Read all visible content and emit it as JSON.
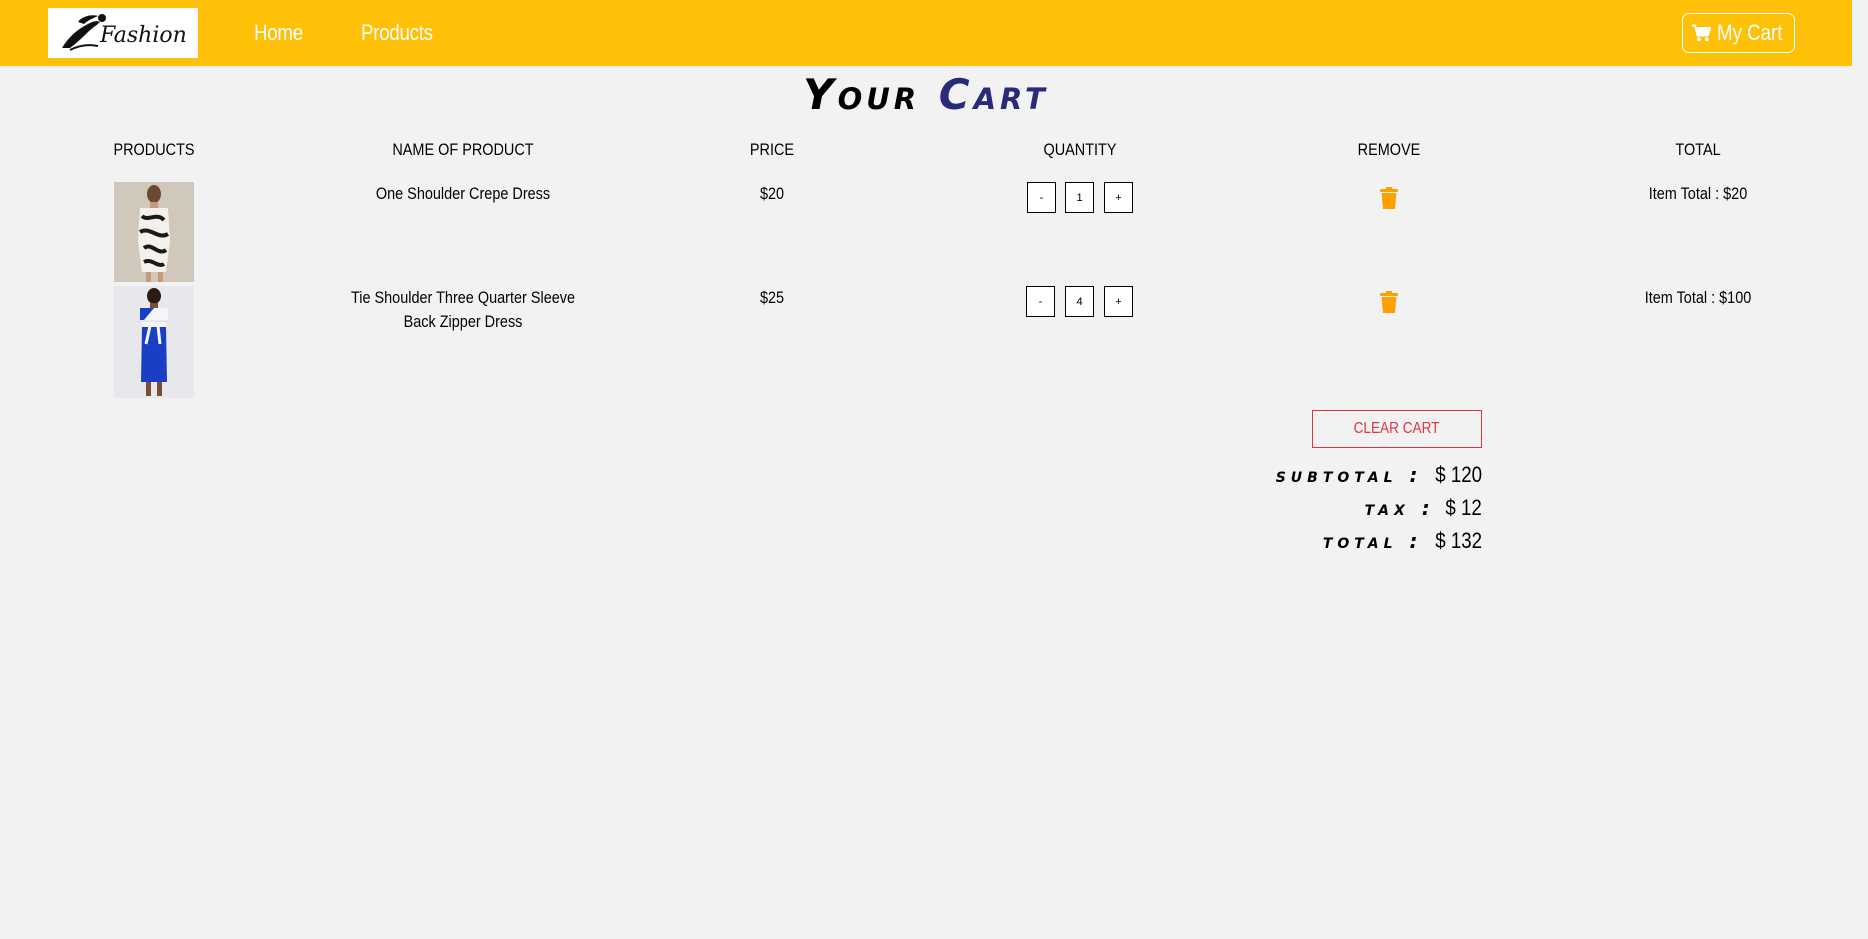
{
  "nav": {
    "logo_text": "Fashion",
    "home_label": "Home",
    "products_label": "Products",
    "cart_label": "My Cart",
    "accent_color": "#ffc107"
  },
  "page": {
    "title_word1": "Your",
    "title_word2": "Cart"
  },
  "table": {
    "headers": [
      "PRODUCTS",
      "NAME OF PRODUCT",
      "PRICE",
      "QUANTITY",
      "REMOVE",
      "TOTAL"
    ],
    "rows": [
      {
        "name": "One Shoulder Crepe Dress",
        "price": "$20",
        "decrement": "-",
        "quantity": "1",
        "increment": "+",
        "remove_icon": "trash-icon",
        "item_total": "Item Total : $20"
      },
      {
        "name": "Tie Shoulder Three Quarter Sleeve Back Zipper Dress",
        "price": "$25",
        "decrement": "-",
        "quantity": "4",
        "increment": "+",
        "remove_icon": "trash-icon",
        "item_total": "Item Total : $100"
      }
    ]
  },
  "summary": {
    "clear_label": "CLEAR CART",
    "subtotal_label": "subtotal :",
    "subtotal_value": "$ 120",
    "tax_label": "tax :",
    "tax_value": "$ 12",
    "total_label": "total :",
    "total_value": "$ 132"
  }
}
